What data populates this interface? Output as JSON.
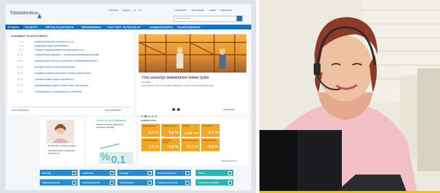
{
  "site": {
    "logo": "Tilastokeskus",
    "top_links": [
      "Etusivulle",
      "Kirjaudu",
      "Sv",
      "En"
    ],
    "top_right_links": [
      "Palvelumme",
      "Tietoa meistä",
      "Palaute",
      "Yhteystiedot"
    ],
    "search_placeholder": "Hae sivustolta",
    "nav": [
      "ETUSIVU",
      "TILASTOT",
      "TIETOA TILASTOISTA",
      "TIEDONKERUU",
      "TUOTTEET JA PALVELUT",
      "AJANKOHTAISTA",
      "TILASTOKESKUS"
    ],
    "latest": {
      "title": "UUSIMMAT TILASTOTIEDOT",
      "items": [
        {
          "date": "2.4.",
          "text": "Kiinteistöverotuksen tunnusluvut 2016"
        },
        {
          "date": "2.4.",
          "text": "Vapaa-ajan väestö ja kausiväestö"
        },
        {
          "date": "2.4.",
          "text": "Yritysten toimialakohtaiset liikevaihtotiedot 2015"
        },
        {
          "date": "31.3.",
          "text": "Julkisyhteisöjen alijäämä 2,7 prosenttia bruttokansantuotteesta"
        },
        {
          "date": "31.3.",
          "text": "Julkisyhteisöjen velka 63,6 prosenttia bruttokansantuotteesta"
        },
        {
          "date": "31.3.",
          "text": "Asuntojen hinnat nousivat helmikuussa"
        },
        {
          "date": "31.3.",
          "text": "Kuluttajien luottamus talouteen vahvistui maaliskuussa"
        },
        {
          "date": "31.3.",
          "text": "Teollisuustuotanto kasvoi helmikuussa"
        },
        {
          "date": "31.3.",
          "text": "Vähittäiskaupan myynnin määrä kasvoi helmikuussa"
        },
        {
          "date": "31.3.",
          "text": "Työttömyysaste oli helmikuussa 8,3 prosenttia"
        }
      ],
      "footer_left": "Kaikki tilastotiedot ›",
      "footer_right": "Julkistuskalenteri ›"
    },
    "feature": {
      "title": "Yhä useampi eläkeläinen tekee työtä",
      "date": "27.3.2015",
      "text": "Työssä käyvien 62–67-vuotiaiden eläkeläisten määrä on kasvanut 2000-luvulla.",
      "footer_right": "Uutisarkisto ›"
    },
    "contact": {
      "title": "ETSITKÖ TILASTOJA?",
      "text": "Tilastokeskuksen tietopalvelu auttaa sinua"
    },
    "education": {
      "title": "TILASTOT OPETUKSEEN",
      "text": "Tilastokoulutusta, julkaisuja ja aineistoja opettajille"
    },
    "indicators": {
      "title": "AVAINLUVUT",
      "items": [
        {
          "label": "Kuluttajahinnat",
          "value": "-0,1 %"
        },
        {
          "label": "Työttömyysaste",
          "value": "8,3 %"
        },
        {
          "label": "Väkiluku",
          "value": "5 482 013"
        },
        {
          "label": "Talouskasvu",
          "value": "-0,1 %"
        },
        {
          "label": "Ansiotasoindeksi",
          "value": "1,1 %"
        },
        {
          "label": "Asuntojen hinnat",
          "value": "-0,9 %"
        },
        {
          "label": "Teollisuustuotanto",
          "value": "10,1 %"
        },
        {
          "label": "Vähittäiskauppa",
          "value": "0,8 %"
        }
      ],
      "footer_right": "Kaikki avainluvut ›"
    },
    "quicklinks": [
      "Hinta-äly",
      "Luokitukset",
      "Kuvaajat",
      "Kuntien avainluvut",
      "Tilastot",
      "Tilastotietokannat",
      "Tilastojulkistukset",
      "Tilastokirjasto",
      "Tilastoja numeroina",
      "Tilastollinen tutkimus"
    ]
  },
  "colors": {
    "nav_blue": "#1473c5",
    "link_blue": "#1e64b4",
    "orange": "#f5a623",
    "teal": "#2bb3b3",
    "ribbon_blue": "#2a8ad0",
    "accent_yellow": "#f2c500"
  }
}
